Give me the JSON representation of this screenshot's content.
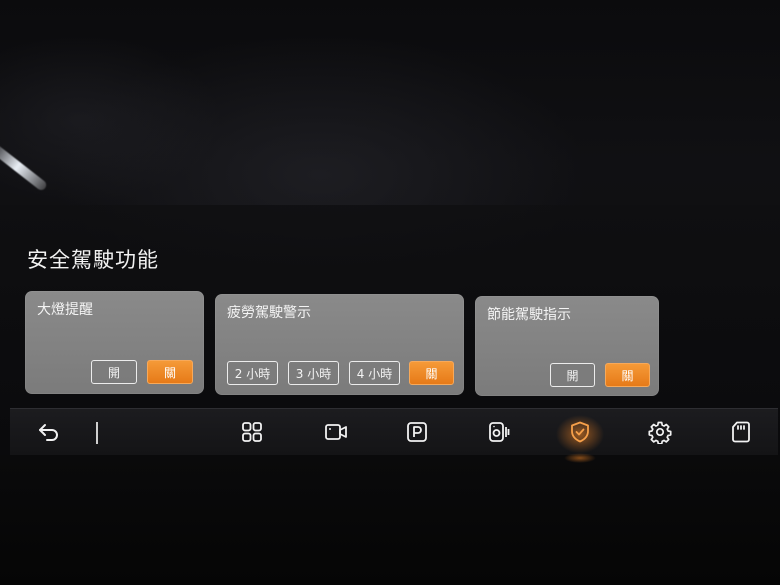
{
  "page": {
    "title": "安全駕駛功能"
  },
  "cards": {
    "headlight_reminder": {
      "title": "大燈提醒",
      "on_label": "開",
      "off_label": "關",
      "selected": "off"
    },
    "fatigue_warning": {
      "title": "疲勞駕駛警示",
      "options": [
        "2 小時",
        "3 小時",
        "4 小時",
        "關"
      ],
      "selected": "關"
    },
    "eco_driving": {
      "title": "節能駕駛指示",
      "on_label": "開",
      "off_label": "關",
      "selected": "off"
    }
  },
  "bottom_bar": {
    "items": [
      {
        "name": "back-icon",
        "active": false
      },
      {
        "name": "apps-grid-icon",
        "active": false
      },
      {
        "name": "video-camera-icon",
        "active": false
      },
      {
        "name": "parking-icon",
        "active": false
      },
      {
        "name": "dashcam-icon",
        "active": false
      },
      {
        "name": "safety-shield-icon",
        "active": true
      },
      {
        "name": "gear-icon",
        "active": false
      },
      {
        "name": "sd-card-icon",
        "active": false
      }
    ]
  },
  "colors": {
    "accent": "#f08a28",
    "card_bg": "#838383",
    "bar_bg": "#18181a"
  }
}
